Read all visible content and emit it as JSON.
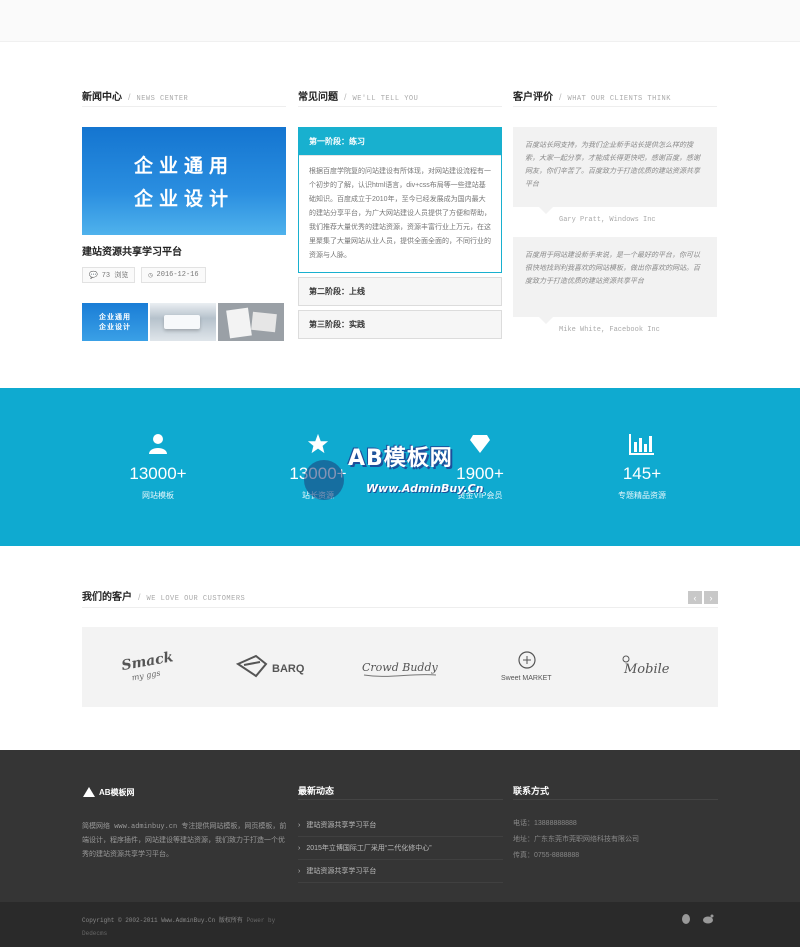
{
  "news": {
    "title_cn": "新闻中心",
    "title_en": "NEWS CENTER",
    "hero_line1": "企业通用",
    "hero_line2": "企业设计",
    "article_title": "建站资源共享学习平台",
    "comments": "73 浏览",
    "date": "2016-12-16",
    "thumb1_line1": "企业通用",
    "thumb1_line2": "企业设计"
  },
  "faq": {
    "title_cn": "常见问题",
    "title_en": "WE'LL TELL YOU",
    "items": [
      {
        "label": "第一阶段：练习",
        "body": "根据百度学院复的问站建设有所体现，对网站建设流程有一个初步的了解，认识html语言，div+css布局等一些建站基础知识。百度成立于2010年，至今已经发展成为国内最大的建站分享平台，为广大网站建设人员提供了方便和帮助，我们推荐大量优秀的建站资源，资源丰富行业上万元，在这里聚集了大量网站从业人员，提供全面全面的，不同行业的资源与人脉。"
      },
      {
        "label": "第二阶段：上线"
      },
      {
        "label": "第三阶段：实践"
      }
    ]
  },
  "reviews": {
    "title_cn": "客户评价",
    "title_en": "WHAT OUR CLIENTS THINK",
    "items": [
      {
        "text": "百度站长网支持，为我们企业新手站长提供怎么样的搜索，大家一起分享，才能成长得更快吧，感谢百度，感谢网友，你们辛苦了。百度致力于打造优质的建站资源共享平台",
        "author": "Gary Pratt, Windows Inc"
      },
      {
        "text": "百度用于网站建设新手来说，是一个最好的平台，你可以很快地找到利我喜欢的网站模板，做出你喜欢的网站。百度致力于打造优质的建站资源共享平台",
        "author": "Mike White, Facebook Inc"
      }
    ]
  },
  "stats": [
    {
      "icon": "user-icon",
      "value": "13000+",
      "label": "网站模板"
    },
    {
      "icon": "star-icon",
      "value": "13000+",
      "label": "站长资源"
    },
    {
      "icon": "diamond-icon",
      "value": "1900+",
      "label": "黄金VIP会员"
    },
    {
      "icon": "chart-icon",
      "value": "145+",
      "label": "专题精品资源"
    }
  ],
  "watermark": {
    "brand": "AB模板网",
    "url": "Www.AdminBuy.Cn"
  },
  "clients": {
    "title_cn": "我们的客户",
    "title_en": "WE LOVE OUR CUSTOMERS",
    "logos": [
      "Smack my ggs",
      "BARQ",
      "Crowd Buddy",
      "Sweet MARKET",
      "Mobile"
    ]
  },
  "footer": {
    "logo_text": "AB模板网",
    "about": "简模网络 www.adminbuy.cn 专注提供网站模板，网页模板，前端设计，程序插件，网站建设等建站资源，我们致力于打造一个优秀的建站资源共享学习平台。",
    "latest_title": "最新动态",
    "latest": [
      "建站资源共享学习平台",
      "2015年立博国际工厂采用“二代化修中心”",
      "建站资源共享学习平台"
    ],
    "contact_title": "联系方式",
    "phone": "电话：13888888888",
    "address": "地址：广东东莞市莞职网络科技有限公司",
    "fax": "传真：0755-8888888",
    "copyright": "Copyright © 2002-2011 Www.AdminBuy.Cn 版权所有",
    "powered": "Power by",
    "powered2": "Dedecms"
  }
}
